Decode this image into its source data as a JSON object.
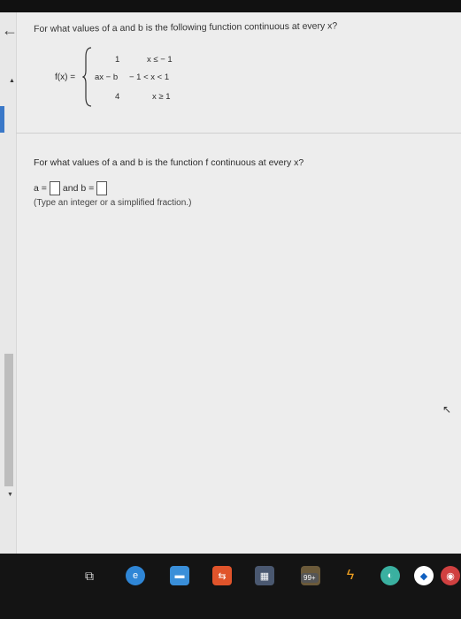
{
  "problem": {
    "question": "For what values of a and b is the following function continuous at every x?",
    "function_name": "f(x) =",
    "pieces": [
      {
        "value": "1",
        "condition": "x ≤ − 1"
      },
      {
        "value": "ax − b",
        "condition": "− 1 < x < 1"
      },
      {
        "value": "4",
        "condition": "x ≥ 1"
      }
    ]
  },
  "answer": {
    "prompt": "For what values of a and b is the function f continuous at every x?",
    "a_label": "a =",
    "and_label": "and b =",
    "hint": "(Type an integer or a simplified fraction.)"
  },
  "taskbar": {
    "badge": "99+"
  }
}
